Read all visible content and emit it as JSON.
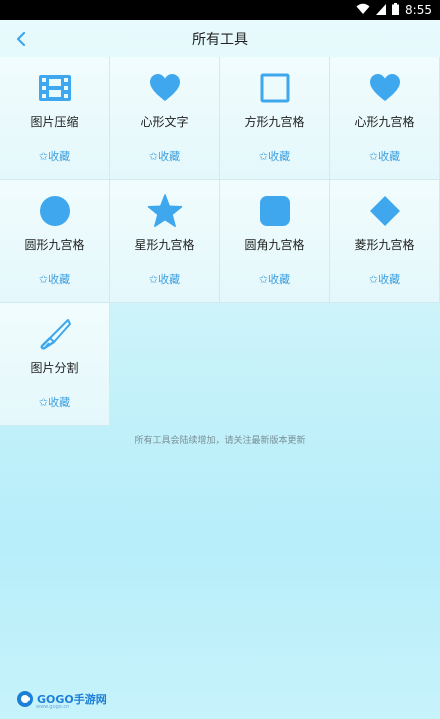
{
  "status_bar": {
    "time": "8:55"
  },
  "header": {
    "title": "所有工具"
  },
  "tools": [
    {
      "label": "图片压缩",
      "fav": "✩收藏",
      "icon": "film-compress-icon"
    },
    {
      "label": "心形文字",
      "fav": "✩收藏",
      "icon": "heart-icon"
    },
    {
      "label": "方形九宫格",
      "fav": "✩收藏",
      "icon": "square-outline-icon"
    },
    {
      "label": "心形九宫格",
      "fav": "✩收藏",
      "icon": "heart-icon"
    },
    {
      "label": "圆形九宫格",
      "fav": "✩收藏",
      "icon": "circle-icon"
    },
    {
      "label": "星形九宫格",
      "fav": "✩收藏",
      "icon": "star-icon"
    },
    {
      "label": "圆角九宫格",
      "fav": "✩收藏",
      "icon": "rounded-square-icon"
    },
    {
      "label": "菱形九宫格",
      "fav": "✩收藏",
      "icon": "diamond-icon"
    },
    {
      "label": "图片分割",
      "fav": "✩收藏",
      "icon": "knife-icon"
    }
  ],
  "notice": "所有工具会陆续增加，请关注最新版本更新",
  "watermark": {
    "brand": "GOGO手游网",
    "site": "www.gogo.cn"
  },
  "colors": {
    "accent": "#3ea7ee",
    "fav_text": "#3c9fe0",
    "status_bar": "#000000"
  }
}
